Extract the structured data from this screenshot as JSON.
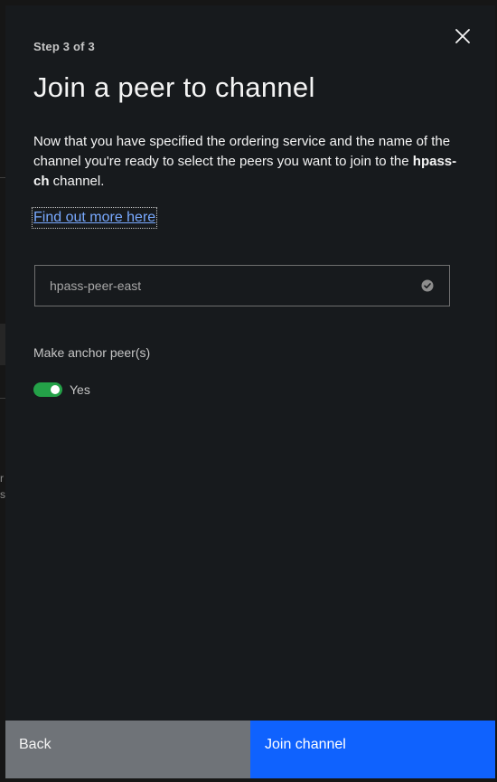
{
  "modal": {
    "step": "Step 3 of 3",
    "title": "Join a peer to channel",
    "description_before": "Now that you have specified the ordering service and the name of the channel you're ready to select the peers you want to join to the ",
    "channel_name": "hpass-ch",
    "description_after": " channel.",
    "learn_more_link": "Find out more here",
    "close_icon": "close-icon"
  },
  "peer_selection": {
    "selected_peer": "hpass-peer-east",
    "icon": "checkmark-filled-icon",
    "checked": true
  },
  "anchor": {
    "label": "Make anchor peer(s)",
    "toggle_on": true,
    "toggle_text": "Yes",
    "toggle_color": "#24a148"
  },
  "footer": {
    "back_label": "Back",
    "join_label": "Join channel",
    "primary_color": "#0f62fe",
    "secondary_color": "#6f7378"
  },
  "background": {
    "fragment_1": "r",
    "fragment_2": "s"
  }
}
